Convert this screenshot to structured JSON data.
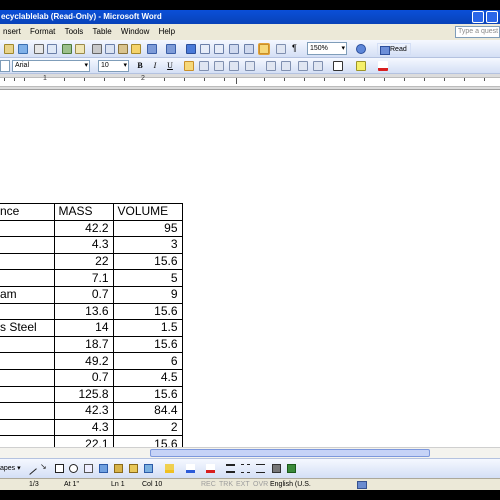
{
  "window": {
    "title": "ecyclablelab (Read-Only) - Microsoft Word"
  },
  "menu": {
    "items": [
      {
        "label": "nsert"
      },
      {
        "label": "Format"
      },
      {
        "label": "Tools"
      },
      {
        "label": "Table"
      },
      {
        "label": "Window"
      },
      {
        "label": "Help"
      }
    ],
    "ask_placeholder": "Type a quest"
  },
  "standard_toolbar": {
    "zoom": "150%",
    "read_label": "Read"
  },
  "formatting_toolbar": {
    "style": "",
    "font": "Arial",
    "size": "10",
    "bold": "B",
    "italic": "I",
    "underline": "U"
  },
  "ruler": {
    "numbers": [
      "1",
      "2"
    ]
  },
  "table": {
    "headers": [
      "nce",
      "MASS",
      "VOLUME"
    ],
    "rows": [
      [
        "",
        "42.2",
        "95"
      ],
      [
        "",
        "4.3",
        "3"
      ],
      [
        "",
        "22",
        "15.6"
      ],
      [
        "",
        "7.1",
        "5"
      ],
      [
        "am",
        "0.7",
        "9"
      ],
      [
        "",
        "13.6",
        "15.6"
      ],
      [
        "s Steel",
        "14",
        "1.5"
      ],
      [
        "",
        "18.7",
        "15.6"
      ],
      [
        "",
        "49.2",
        "6"
      ],
      [
        "",
        "0.7",
        "4.5"
      ],
      [
        "",
        "125.8",
        "15.6"
      ],
      [
        "",
        "42.3",
        "84.4"
      ],
      [
        "",
        "4.3",
        "2"
      ],
      [
        "",
        "22.1",
        "15.6"
      ]
    ]
  },
  "drawing_toolbar": {
    "label": "apes ▾"
  },
  "statusbar": {
    "page": "1/3",
    "at": "At 1\"",
    "line": "Ln 1",
    "col": "Col 10",
    "rec": "REC",
    "trk": "TRK",
    "ext": "EXT",
    "ovr": "OVR",
    "language": "English (U.S."
  },
  "colors": {
    "titlebar": "#0a4fd8",
    "menubar": "#ece9d8",
    "toolbar": "#d4dff5"
  }
}
